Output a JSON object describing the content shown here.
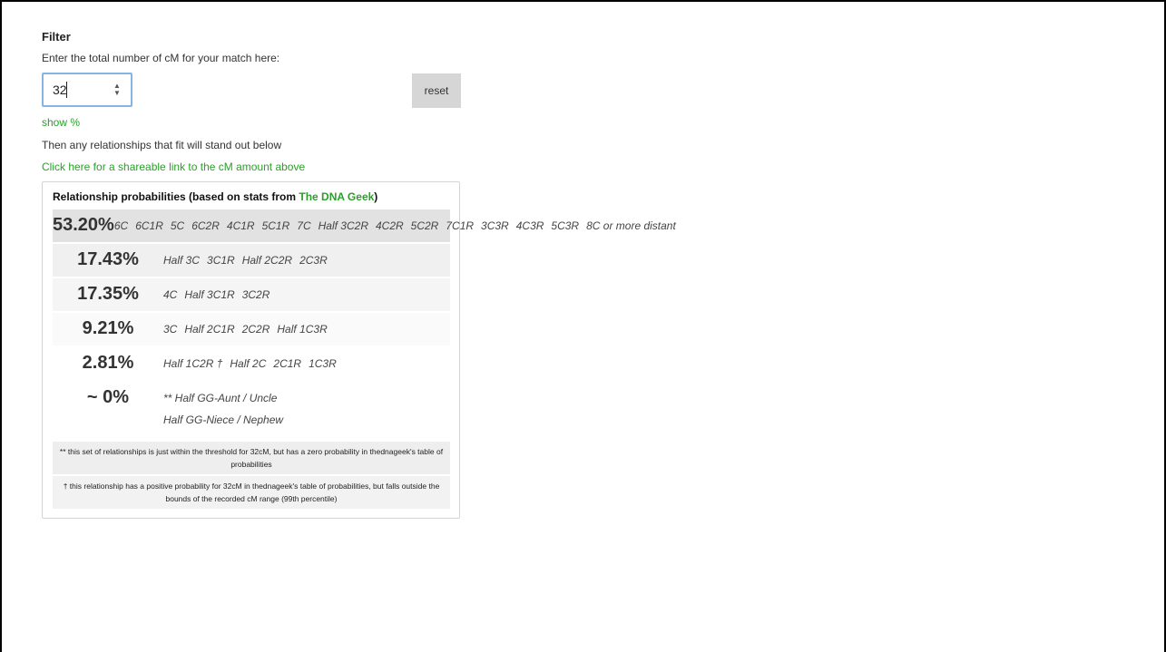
{
  "filter": {
    "title": "Filter",
    "prompt": "Enter the total number of cM for your match here:",
    "cm_value": "32",
    "reset_label": "reset",
    "show_percent": "show %",
    "then_text": "Then any relationships that fit will stand out below",
    "share_link": "Click here for a shareable link to the cM amount above"
  },
  "panel": {
    "title_prefix": "Relationship probabilities (based on stats from ",
    "source": "The DNA Geek",
    "title_suffix": ")",
    "rows": [
      {
        "pct": "53.20%",
        "rels": [
          "6C",
          "6C1R",
          "5C",
          "6C2R",
          "4C1R",
          "5C1R",
          "7C",
          "Half 3C2R",
          "4C2R",
          "5C2R",
          "7C1R",
          "3C3R",
          "4C3R",
          "5C3R",
          "8C or more distant"
        ]
      },
      {
        "pct": "17.43%",
        "rels": [
          "Half 3C",
          "3C1R",
          "Half 2C2R",
          "2C3R"
        ]
      },
      {
        "pct": "17.35%",
        "rels": [
          "4C",
          "Half 3C1R",
          "3C2R"
        ]
      },
      {
        "pct": "9.21%",
        "rels": [
          "3C",
          "Half 2C1R",
          "2C2R",
          "Half 1C3R"
        ]
      },
      {
        "pct": "2.81%",
        "rels": [
          "Half 1C2R †",
          "Half 2C",
          "2C1R",
          "1C3R"
        ]
      },
      {
        "pct": "~ 0%",
        "rels": [
          "** Half GG-Aunt / Uncle",
          "Half GG-Niece / Nephew"
        ]
      }
    ],
    "notes": [
      "** this set of relationships is just within the threshold for 32cM, but has a zero probability in thednageek's table of probabilities",
      "† this relationship has a positive probability for 32cM in thednageek's table of probabilities, but falls outside the bounds of the recorded cM range (99th percentile)"
    ]
  }
}
